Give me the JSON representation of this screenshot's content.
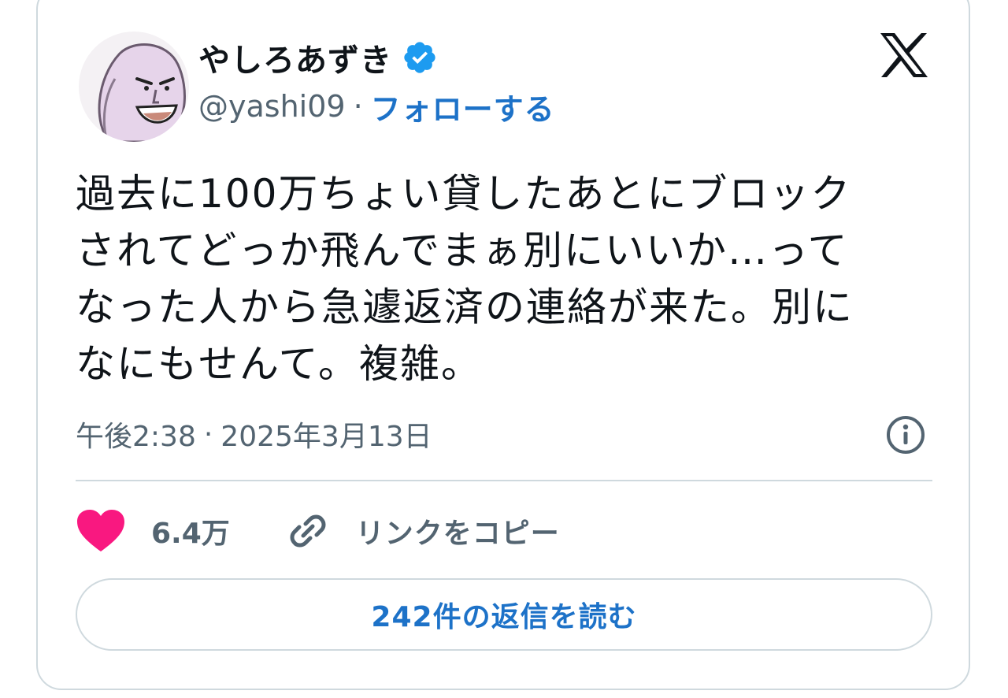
{
  "author": {
    "display_name": "やしろあずき",
    "handle": "@yashi09",
    "separator": "·",
    "follow_label": "フォローする",
    "verified_icon": "verified-badge-icon",
    "verified_color": "#1d9bf0"
  },
  "tweet": {
    "text": "過去に100万ちょい貸したあとにブロック\nされてどっか飛んでまぁ別にいいか…って\nなった人から急遽返済の連絡が来た。別に\nなにもせんて。複雑。",
    "time": "午後2:38",
    "date": "2025年3月13日",
    "meta_separator": "·"
  },
  "actions": {
    "like_count": "6.4万",
    "like_color": "#f91880",
    "copy_link_label": "リンクをコピー"
  },
  "replies": {
    "button_label": "242件の返信を読む"
  },
  "colors": {
    "accent": "#1d72c8",
    "muted": "#536471",
    "border": "#cfd9de"
  }
}
